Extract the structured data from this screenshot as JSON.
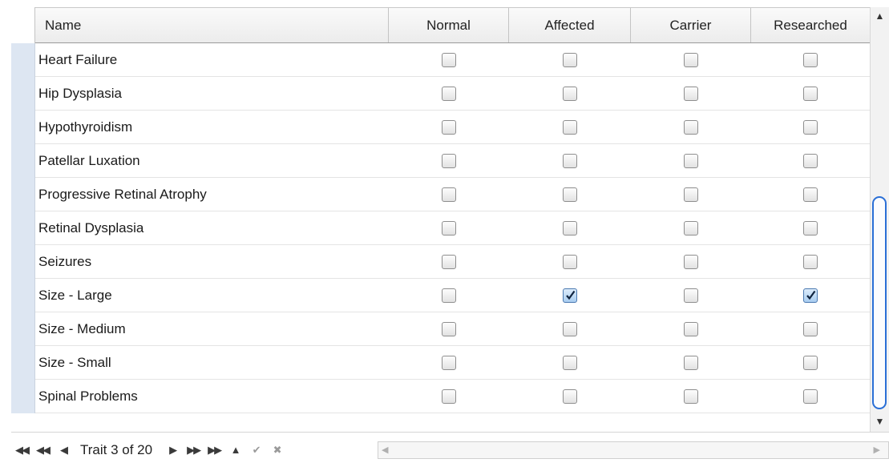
{
  "columns": {
    "name": "Name",
    "normal": "Normal",
    "affected": "Affected",
    "carrier": "Carrier",
    "researched": "Researched"
  },
  "rows": [
    {
      "name": "Heart Failure",
      "normal": false,
      "affected": false,
      "carrier": false,
      "researched": false
    },
    {
      "name": "Hip Dysplasia",
      "normal": false,
      "affected": false,
      "carrier": false,
      "researched": false
    },
    {
      "name": "Hypothyroidism",
      "normal": false,
      "affected": false,
      "carrier": false,
      "researched": false
    },
    {
      "name": "Patellar Luxation",
      "normal": false,
      "affected": false,
      "carrier": false,
      "researched": false
    },
    {
      "name": "Progressive Retinal Atrophy",
      "normal": false,
      "affected": false,
      "carrier": false,
      "researched": false
    },
    {
      "name": "Retinal Dysplasia",
      "normal": false,
      "affected": false,
      "carrier": false,
      "researched": false
    },
    {
      "name": "Seizures",
      "normal": false,
      "affected": false,
      "carrier": false,
      "researched": false
    },
    {
      "name": "Size - Large",
      "normal": false,
      "affected": true,
      "carrier": false,
      "researched": true
    },
    {
      "name": "Size - Medium",
      "normal": false,
      "affected": false,
      "carrier": false,
      "researched": false
    },
    {
      "name": "Size - Small",
      "normal": false,
      "affected": false,
      "carrier": false,
      "researched": false
    },
    {
      "name": "Spinal Problems",
      "normal": false,
      "affected": false,
      "carrier": false,
      "researched": false
    }
  ],
  "navigator": {
    "status": "Trait 3 of 20",
    "buttons": [
      "first",
      "prev-page",
      "prev",
      "next",
      "next-page",
      "last",
      "insert",
      "post",
      "cancel"
    ]
  }
}
